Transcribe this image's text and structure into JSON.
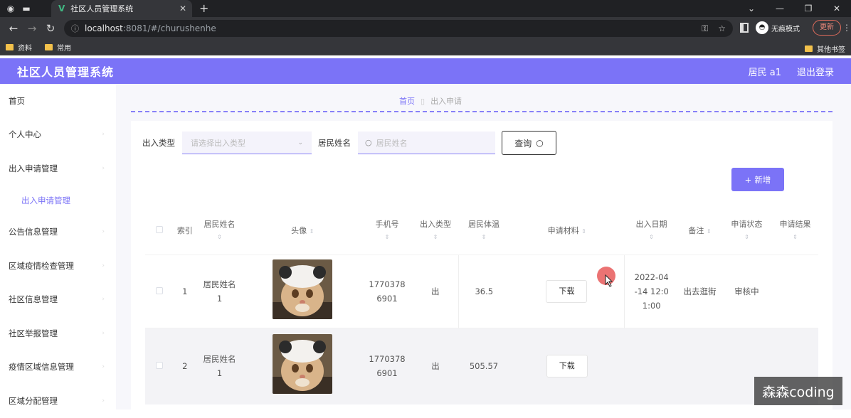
{
  "browser": {
    "tab_title": "社区人员管理系统",
    "url_host": "localhost",
    "url_path": ":8081/#/churushenhe",
    "incognito_label": "无痕模式",
    "update_label": "更新",
    "bookmarks": [
      "资料",
      "常用"
    ],
    "other_bookmarks": "其他书签"
  },
  "header": {
    "app_title": "社区人员管理系统",
    "user": "居民 a1",
    "logout": "退出登录"
  },
  "sidebar": {
    "items": [
      {
        "label": "首页"
      },
      {
        "label": "个人中心"
      },
      {
        "label": "出入申请管理"
      },
      {
        "label": "出入申请管理"
      },
      {
        "label": "公告信息管理"
      },
      {
        "label": "区域疫情检查管理"
      },
      {
        "label": "社区信息管理"
      },
      {
        "label": "社区举报管理"
      },
      {
        "label": "疫情区域信息管理"
      },
      {
        "label": "区域分配管理"
      }
    ]
  },
  "breadcrumb": {
    "home": "首页",
    "current": "出入申请"
  },
  "search": {
    "type_label": "出入类型",
    "type_placeholder": "请选择出入类型",
    "name_label": "居民姓名",
    "name_placeholder": "居民姓名",
    "query_button": "查询"
  },
  "add_button": "新增",
  "table": {
    "headers": [
      "索引",
      "居民姓名",
      "头像",
      "手机号",
      "出入类型",
      "居民体温",
      "申请材料",
      "出入日期",
      "备注",
      "申请状态",
      "申请结果"
    ],
    "rows": [
      {
        "index": "1",
        "name": "居民姓名1",
        "phone": "17703786901",
        "type": "出",
        "temp": "36.5",
        "material": "下载",
        "date": "2022-04-14 12:01:00",
        "note": "出去逛街",
        "status": "审核中",
        "result": ""
      },
      {
        "index": "2",
        "name": "居民姓名1",
        "phone": "17703786901",
        "type": "出",
        "temp": "505.57",
        "material": "下载",
        "date": "",
        "note": "",
        "status": "",
        "result": ""
      }
    ]
  },
  "watermark": "森森coding",
  "colors": {
    "accent": "#7b73f7",
    "browser_dark": "#202124"
  }
}
